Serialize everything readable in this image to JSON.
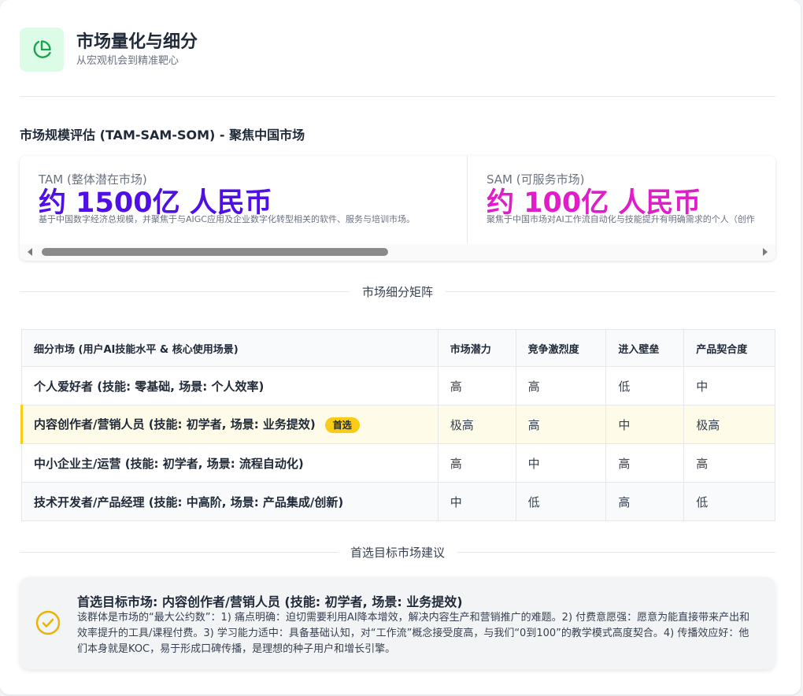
{
  "header": {
    "title": "市场量化与细分",
    "subtitle": "从宏观机会到精准靶心"
  },
  "sizing": {
    "title": "市场规模评估 (TAM-SAM-SOM) - 聚焦中国市场",
    "metrics": [
      {
        "label": "TAM (整体潜在市场)",
        "value": "约 1500亿 人民币",
        "color": "#4f0fe6",
        "desc": "基于中国数字经济总规模，并聚焦于与AIGC应用及企业数字化转型相关的软件、服务与培训市场。"
      },
      {
        "label": "SAM (可服务市场)",
        "value": "约 100亿 人民币",
        "color": "#e11dc9",
        "desc": "聚焦于中国市场对AI工作流自动化与技能提升有明确需求的个人（创作"
      }
    ]
  },
  "segmentation": {
    "divider": "市场细分矩阵",
    "headers": [
      "细分市场 (用户AI技能水平 & 核心使用场景)",
      "市场潜力",
      "竞争激烈度",
      "进入壁垒",
      "产品契合度"
    ],
    "badge": "首选",
    "rows": [
      {
        "segment": "个人爱好者 (技能: 零基础, 场景: 个人效率)",
        "potential": "高",
        "competition": "高",
        "barrier": "低",
        "fit": "中"
      },
      {
        "segment": "内容创作者/营销人员 (技能: 初学者, 场景: 业务提效)",
        "potential": "极高",
        "competition": "高",
        "barrier": "中",
        "fit": "极高"
      },
      {
        "segment": "中小企业主/运营 (技能: 初学者, 场景: 流程自动化)",
        "potential": "高",
        "competition": "中",
        "barrier": "高",
        "fit": "高"
      },
      {
        "segment": "技术开发者/产品经理 (技能: 中高阶, 场景: 产品集成/创新)",
        "potential": "中",
        "competition": "低",
        "barrier": "高",
        "fit": "低"
      }
    ]
  },
  "recommendation": {
    "divider": "首选目标市场建议",
    "title": "首选目标市场: 内容创作者/营销人员 (技能: 初学者, 场景: 业务提效)",
    "body": "该群体是市场的“最大公约数”：1) 痛点明确：迫切需要利用AI降本增效，解决内容生产和营销推广的难题。2) 付费意愿强：愿意为能直接带来产出和效率提升的工具/课程付费。3) 学习能力适中：具备基础认知，对“工作流”概念接受度高，与我们“0到100”的教学模式高度契合。4) 传播效应好：他们本身就是KOC，易于形成口碑传播，是理想的种子用户和增长引擎。"
  },
  "colors": {
    "accent_green": "#16a34a",
    "accent_yellow": "#facc15",
    "tam": "#4f0fe6",
    "sam": "#e11dc9"
  }
}
